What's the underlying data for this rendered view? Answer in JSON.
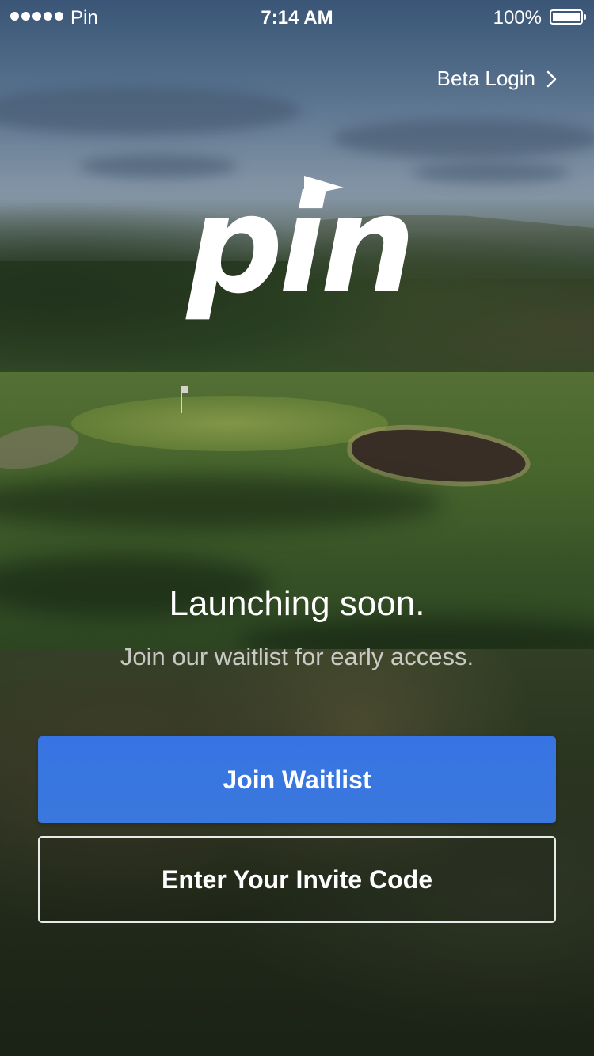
{
  "status_bar": {
    "carrier": "Pin",
    "time": "7:14 AM",
    "battery_percent": "100%"
  },
  "header": {
    "beta_login_label": "Beta Login"
  },
  "brand": {
    "logo_text": "pin",
    "accent_color": "#3a78e0"
  },
  "hero": {
    "headline": "Launching soon.",
    "subline": "Join our waitlist for early access."
  },
  "actions": {
    "join_waitlist_label": "Join Waitlist",
    "invite_code_label": "Enter Your Invite Code"
  },
  "icons": {
    "signal": "signal-dots-icon",
    "battery": "battery-full-icon",
    "beta_chevron": "chevron-right-icon",
    "logo_pennant": "pennant-flag-icon"
  }
}
